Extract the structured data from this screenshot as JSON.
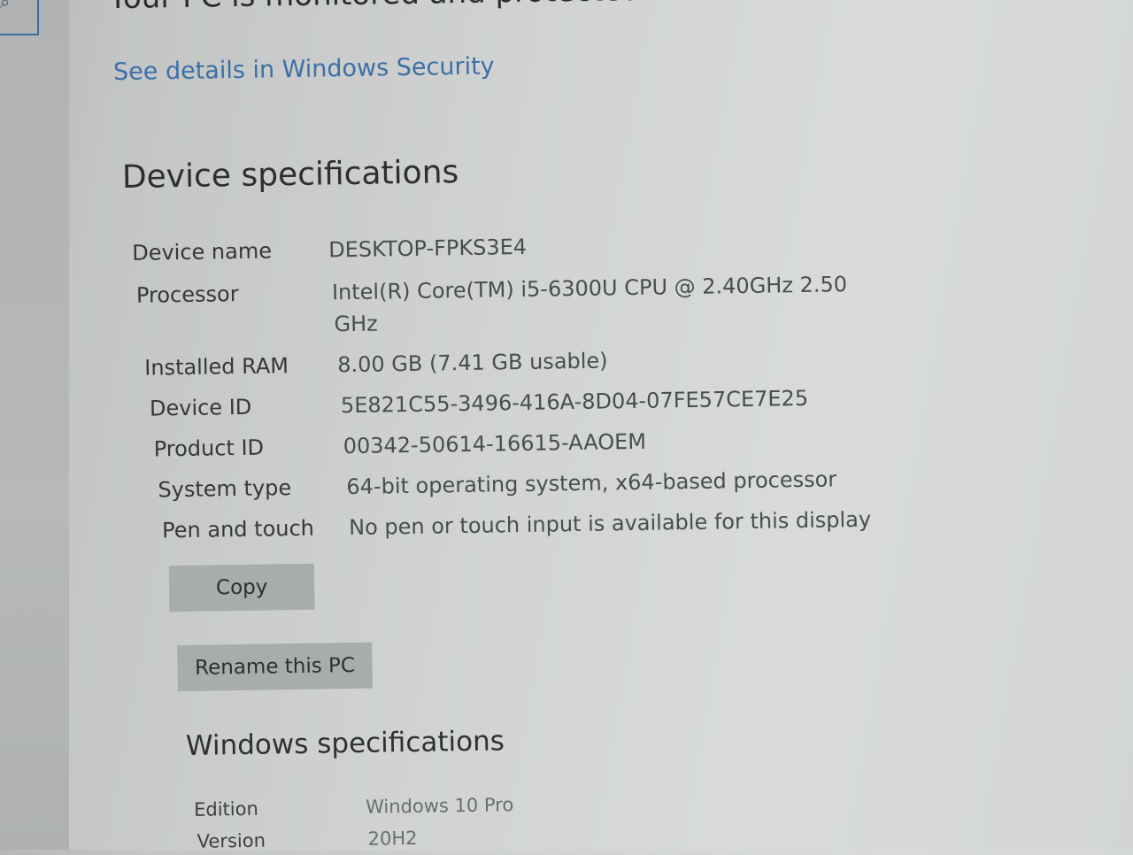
{
  "header": {
    "status_text": "Your PC is monitored and protected.",
    "security_link": "See details in Windows Security"
  },
  "device_specs": {
    "title": "Device specifications",
    "rows": [
      {
        "label": "Device name",
        "value": "DESKTOP-FPKS3E4"
      },
      {
        "label": "Processor",
        "value": "Intel(R) Core(TM) i5-6300U CPU @ 2.40GHz   2.50",
        "value_line2": "GHz"
      },
      {
        "label": "Installed RAM",
        "value": "8.00 GB (7.41 GB usable)"
      },
      {
        "label": "Device ID",
        "value": "5E821C55-3496-416A-8D04-07FE57CE7E25"
      },
      {
        "label": "Product ID",
        "value": "00342-50614-16615-AAOEM"
      },
      {
        "label": "System type",
        "value": "64-bit operating system, x64-based processor"
      },
      {
        "label": "Pen and touch",
        "value": "No pen or touch input is available for this display"
      }
    ],
    "copy_button": "Copy",
    "rename_button": "Rename this PC"
  },
  "windows_specs": {
    "title": "Windows specifications",
    "rows": [
      {
        "label": "Edition",
        "value": "Windows 10 Pro"
      },
      {
        "label": "Version",
        "value": "20H2"
      }
    ]
  },
  "icons": {
    "search": "search-icon"
  },
  "colors": {
    "link": "#3e6fa6",
    "button_bg": "#a9acac",
    "accent_border": "#3a6ea3"
  }
}
